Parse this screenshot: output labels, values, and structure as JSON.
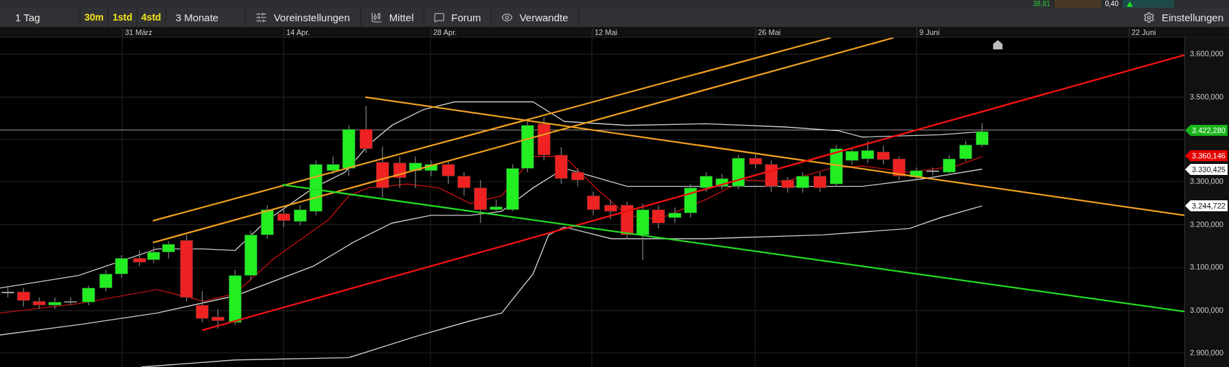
{
  "ticker_strip": {
    "column_1": "38,81",
    "column_2": "0,40"
  },
  "toolbar": {
    "range": "1 Tag",
    "intervals": [
      "30m",
      "1std",
      "4std"
    ],
    "period": "3 Monate",
    "buttons": [
      {
        "label": "Voreinstellungen",
        "kind": "presets"
      },
      {
        "label": "Mittel",
        "kind": "indicators"
      },
      {
        "label": "Forum",
        "kind": "forum"
      },
      {
        "label": "Verwandte",
        "kind": "related"
      }
    ],
    "settings": "Einstellungen"
  },
  "date_axis": [
    "31 März",
    "14 Apr.",
    "28 Apr.",
    "12 Mai",
    "26 Mai",
    "9 Juni",
    "22 Juni"
  ],
  "price_axis": [
    "3.600,000",
    "3.500,000",
    "3.300,000",
    "3.200,000",
    "3.100,000",
    "3.000,000",
    "2.900,000"
  ],
  "price_tags": [
    {
      "text": "3.422,280",
      "kind": "last"
    },
    {
      "text": "3.360,146",
      "kind": "average"
    },
    {
      "text": "3.330,425",
      "kind": "band"
    },
    {
      "text": "3.244,722",
      "kind": "band"
    }
  ]
}
